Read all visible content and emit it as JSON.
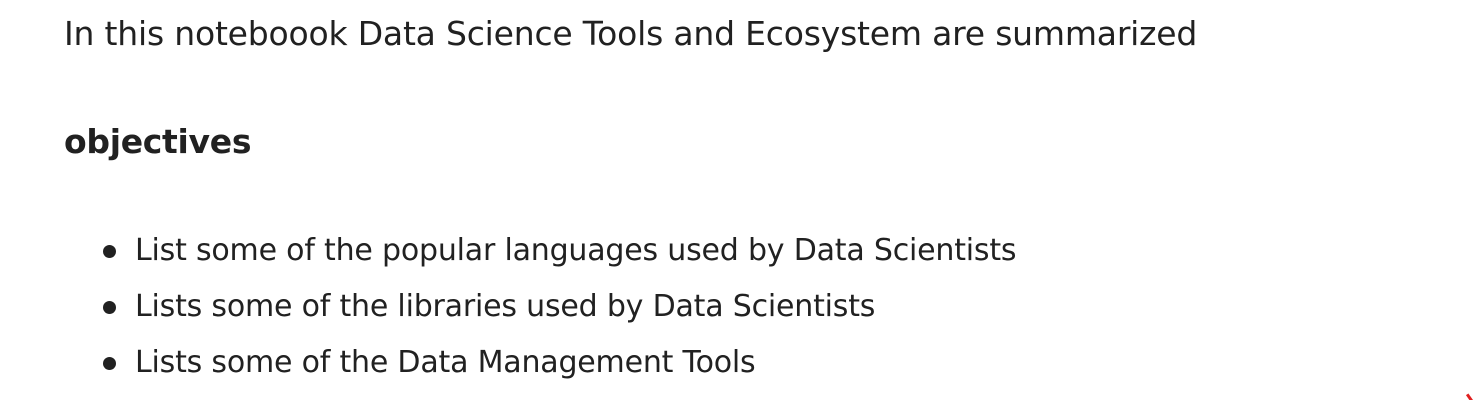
{
  "markdown_cell": {
    "intro": "In this noteboook Data Science Tools and Ecosystem are summarized",
    "heading": "objectives",
    "items": [
      "List some of the popular languages used by Data Scientists",
      "Lists some of the libraries used by Data Scientists",
      "Lists some of the Data Management Tools"
    ]
  },
  "colors": {
    "text": "#212121",
    "background": "#ffffff",
    "corner_mark": "#e02020"
  }
}
